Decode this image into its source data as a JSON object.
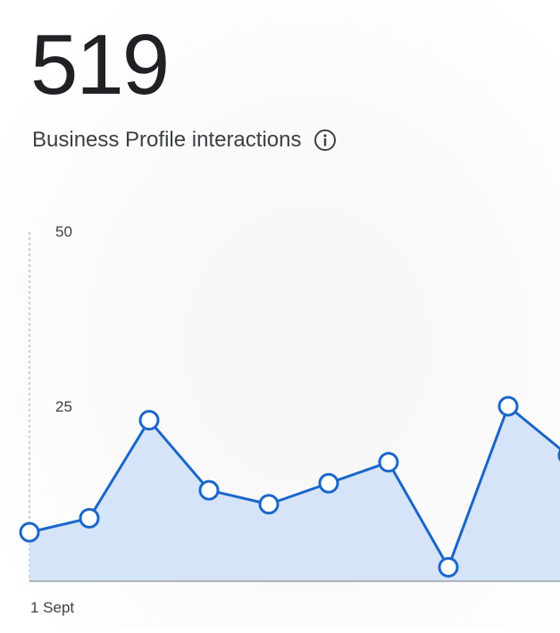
{
  "metric": {
    "value": "519",
    "label": "Business Profile interactions",
    "info_icon": "info-circle-icon"
  },
  "colors": {
    "line": "#1a66c9",
    "fill": "#d5e4f8",
    "marker_fill": "#ffffff",
    "axis": "#9aa0a6",
    "text": "#3c4043"
  },
  "chart_data": {
    "type": "area",
    "title": "",
    "xlabel": "",
    "ylabel": "",
    "x_tick_labels": [
      "1 Sept"
    ],
    "y_ticks": [
      25,
      50
    ],
    "ylim": [
      0,
      50
    ],
    "grid": false,
    "series": [
      {
        "values": [
          7,
          9,
          23,
          13,
          11,
          14,
          17,
          2,
          25,
          18
        ]
      }
    ]
  }
}
